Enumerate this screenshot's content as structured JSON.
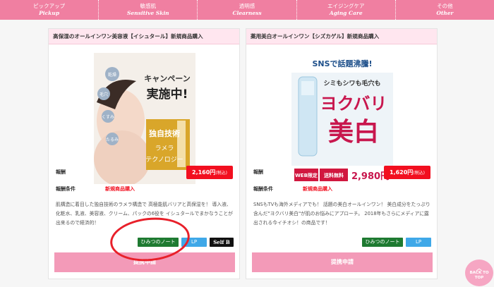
{
  "nav": {
    "items": [
      {
        "jp": "ピックアップ",
        "en": "Pickup"
      },
      {
        "jp": "敏感肌",
        "en": "Sensitive Skin"
      },
      {
        "jp": "透明感",
        "en": "Clearness"
      },
      {
        "jp": "エイジングケア",
        "en": "Aging Care"
      },
      {
        "jp": "その他",
        "en": "Other"
      }
    ]
  },
  "cards": [
    {
      "title": "高保湿のオールインワン美容液【イシュタール】新規商品購入",
      "banner": {
        "line1": "キャンペーン",
        "line2": "実施中!",
        "badge1": "独自技術",
        "badge2": "ラメラ",
        "badge3": "テクノロジー",
        "bubbles": [
          "乾燥",
          "毛穴",
          "くすみ",
          "たるみ"
        ]
      },
      "reward_label": "報酬",
      "price": "2,160円",
      "price_tax": "(税込)",
      "condition_label": "報酬条件",
      "condition_value": "新規商品購入",
      "description": "肌構造に着目した独自技術のラメラ構造で 高極能肌バリアと高保湿を！ 導入液、化粧水、乳液、美容液、クリーム、パックの6役を イシュタールでまかなうことが出来るので経済的！",
      "buttons": {
        "hm": "ひみつのノート",
        "lp": "LP",
        "selfb": "Self B"
      },
      "apply": "提携申請"
    },
    {
      "title": "薬用美白オールインワン【シズカゲル】新規商品購入",
      "banner": {
        "top": "SNSで話題沸騰!",
        "sub": "シミもシワも毛穴も",
        "big1": "ヨクバリ",
        "big2": "美白",
        "tag1": "WEB限定",
        "tag2": "送料無料",
        "price": "2,980円"
      },
      "reward_label": "報酬",
      "price": "1,620円",
      "price_tax": "(税込)",
      "condition_label": "報酬条件",
      "condition_value": "新規商品購入",
      "description": "SNSもTVも海外メディアでも！ 話題の美白オールインワン！ 美白成分をたっぷり含んだ\"ヨクバリ美白\"が肌のお悩みにアプローチ。 2018年もさらにメディアに露出される今イチオシ！の商品です！",
      "buttons": {
        "hm": "ひみつのノート",
        "lp": "LP"
      },
      "apply": "提携申請"
    }
  ],
  "back_to_top": {
    "line1": "BACK TO",
    "line2": "TOP"
  },
  "colors": {
    "nav": "#f07fa1",
    "apply": "#f39ab8",
    "price": "#f20f1f",
    "annotation": "#e8202a"
  }
}
